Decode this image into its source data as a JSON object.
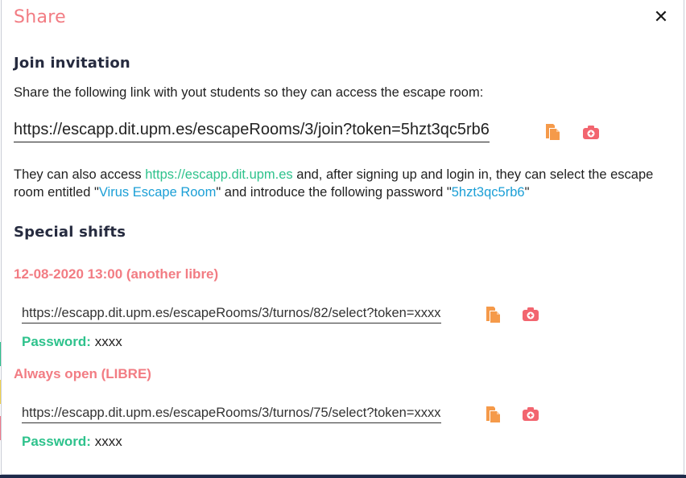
{
  "modal": {
    "title": "Share",
    "close_label": "✕"
  },
  "join": {
    "heading": "Join invitation",
    "instructions": "Share the following link with yout students so they can access the escape room:",
    "link": "https://escapp.dit.upm.es/escapeRooms/3/join?token=5hzt3qc5rb6",
    "also_prefix": "They can also access ",
    "site_link": "https://escapp.dit.upm.es",
    "also_mid": " and, after signing up and login in, they can select the escape",
    "also_line2_prefix": "room entitled \"",
    "room_name": "Virus Escape Room",
    "also_line2_mid": "\" and introduce the following password \"",
    "password": "5hzt3qc5rb6",
    "also_line2_suffix": "\""
  },
  "special": {
    "heading": "Special shifts",
    "shifts": [
      {
        "title": "12-08-2020 13:00 (another libre)",
        "link": "https://escapp.dit.upm.es/escapeRooms/3/turnos/82/select?token=xxxx",
        "password_label": "Password:",
        "password": "xxxx"
      },
      {
        "title": "Always open (LIBRE)",
        "link": "https://escapp.dit.upm.es/escapeRooms/3/turnos/75/select?token=xxxx",
        "password_label": "Password:",
        "password": "xxxx"
      }
    ]
  },
  "icons": {
    "copy": "copy-icon",
    "qr": "camera-icon"
  },
  "colors": {
    "title": "#f27c83",
    "green": "#2ec28c",
    "blue": "#1b9fd6",
    "copy_icon": "#f59a4a",
    "qr_icon": "#f2656f"
  }
}
